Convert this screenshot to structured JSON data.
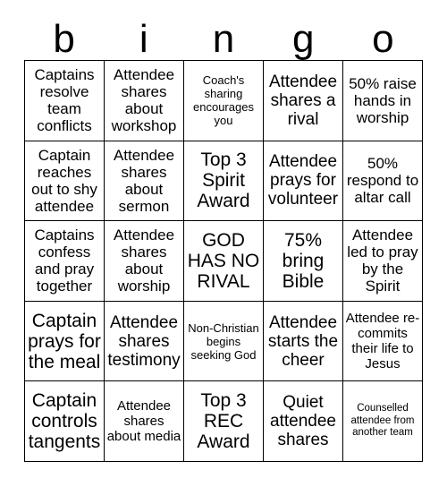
{
  "card": {
    "title": "bingo",
    "header_letters": [
      "b",
      "i",
      "n",
      "g",
      "o"
    ],
    "grid_size": "5x5",
    "colors": {
      "border": "#000000",
      "cell_background": "#ffffff",
      "text": "#000000",
      "page_background": "#ffffff"
    },
    "rows": [
      [
        {
          "text": "Captains resolve team conflicts",
          "size": "md"
        },
        {
          "text": "Attendee shares about workshop",
          "size": "md"
        },
        {
          "text": "Coach's sharing encourages you",
          "size": "xs"
        },
        {
          "text": "Attendee shares a rival",
          "size": "lg"
        },
        {
          "text": "50% raise hands in worship",
          "size": "md"
        }
      ],
      [
        {
          "text": "Captain reaches out to shy attendee",
          "size": "md"
        },
        {
          "text": "Attendee shares about sermon",
          "size": "md"
        },
        {
          "text": "Top 3 Spirit Award",
          "size": "xl"
        },
        {
          "text": "Attendee prays for volunteer",
          "size": "lg"
        },
        {
          "text": "50% respond to altar call",
          "size": "md"
        }
      ],
      [
        {
          "text": "Captains confess and pray together",
          "size": "md"
        },
        {
          "text": "Attendee shares about worship",
          "size": "md"
        },
        {
          "text": "GOD HAS NO RIVAL",
          "size": "xl"
        },
        {
          "text": "75% bring Bible",
          "size": "xl"
        },
        {
          "text": "Attendee led to pray by the Spirit",
          "size": "md"
        }
      ],
      [
        {
          "text": "Captain prays for the meal",
          "size": "xl"
        },
        {
          "text": "Attendee shares testimony",
          "size": "lg"
        },
        {
          "text": "Non-Christian begins seeking God",
          "size": "xs"
        },
        {
          "text": "Attendee starts the cheer",
          "size": "lg"
        },
        {
          "text": "Attendee re-commits their life to Jesus",
          "size": "sm"
        }
      ],
      [
        {
          "text": "Captain controls tangents",
          "size": "xl"
        },
        {
          "text": "Attendee shares about media",
          "size": "sm"
        },
        {
          "text": "Top 3 REC Award",
          "size": "xl"
        },
        {
          "text": "Quiet attendee shares",
          "size": "lg"
        },
        {
          "text": "Counselled attendee from another team",
          "size": "xxs"
        }
      ]
    ]
  }
}
